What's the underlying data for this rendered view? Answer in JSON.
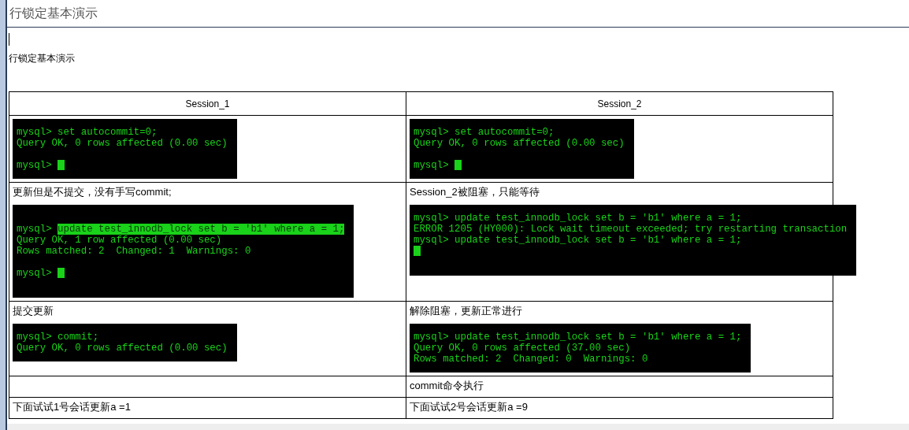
{
  "title": "行锁定基本演示",
  "heading": "行锁定基本演示",
  "table": {
    "columns": [
      "Session_1",
      "Session_2"
    ],
    "rows": [
      [
        {
          "terminal": {
            "lines": [
              {
                "kind": "text",
                "text": "mysql> set autocommit=0;"
              },
              {
                "kind": "text",
                "text": "Query OK, 0 rows affected (0.00 sec)"
              },
              {
                "kind": "blank"
              },
              {
                "kind": "prompt",
                "text": "mysql>"
              }
            ]
          }
        },
        {
          "terminal": {
            "lines": [
              {
                "kind": "text",
                "text": "mysql> set autocommit=0;"
              },
              {
                "kind": "text",
                "text": "Query OK, 0 rows affected (0.00 sec)"
              },
              {
                "kind": "blank"
              },
              {
                "kind": "prompt",
                "text": "mysql>"
              }
            ]
          }
        }
      ],
      [
        {
          "note": "更新但是不提交，没有手写commit;",
          "terminal": {
            "lines": [
              {
                "kind": "blank"
              },
              {
                "kind": "text",
                "text": "mysql>",
                "selection": "update test_innodb_lock set b = 'b1' where a = 1;"
              },
              {
                "kind": "text",
                "text": "Query OK, 1 row affected (0.00 sec)"
              },
              {
                "kind": "text",
                "text": "Rows matched: 2  Changed: 1  Warnings: 0"
              },
              {
                "kind": "blank"
              },
              {
                "kind": "prompt",
                "text": "mysql>"
              },
              {
                "kind": "blank"
              }
            ]
          }
        },
        {
          "note": "Session_2被阻塞，只能等待",
          "terminal": {
            "lines": [
              {
                "kind": "text",
                "text": "mysql> update test_innodb_lock set b = 'b1' where a = 1;"
              },
              {
                "kind": "text",
                "text": "ERROR 1205 (HY000): Lock wait timeout exceeded; try restarting transaction"
              },
              {
                "kind": "text",
                "text": "mysql> update test_innodb_lock set b = 'b1' where a = 1;"
              },
              {
                "kind": "cursor"
              },
              {
                "kind": "blank"
              }
            ]
          }
        }
      ],
      [
        {
          "note": "提交更新",
          "terminal": {
            "lines": [
              {
                "kind": "text",
                "text": "mysql> commit;"
              },
              {
                "kind": "text",
                "text": "Query OK, 0 rows affected (0.00 sec)"
              }
            ]
          }
        },
        {
          "note": "解除阻塞，更新正常进行",
          "terminal": {
            "lines": [
              {
                "kind": "text",
                "text": "mysql> update test_innodb_lock set b = 'b1' where a = 1;"
              },
              {
                "kind": "text",
                "text": "Query OK, 0 rows affected (37.00 sec)"
              },
              {
                "kind": "text",
                "text": "Rows matched: 2  Changed: 0  Warnings: 0"
              }
            ]
          }
        }
      ],
      [
        {},
        {
          "note": "commit命令执行"
        }
      ],
      [
        {
          "note": "下面试试1号会话更新a =1"
        },
        {
          "note": "下面试试2号会话更新a =9"
        }
      ]
    ]
  }
}
